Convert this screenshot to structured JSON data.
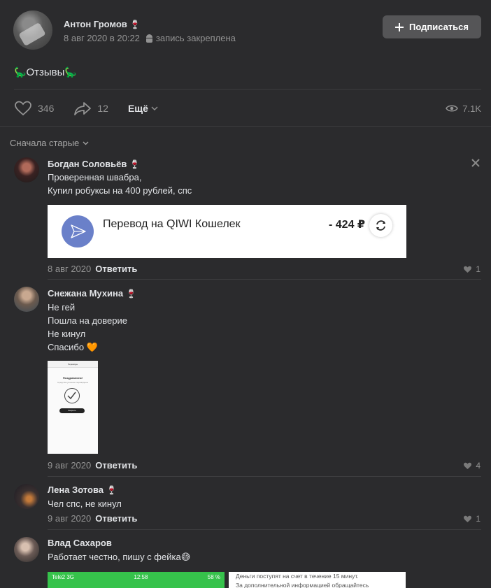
{
  "post": {
    "author": "Антон Громов",
    "wine_emoji": "🍷",
    "date": "8 авг 2020 в 20:22",
    "pinned_label": "запись закреплена",
    "subscribe_label": "Подписаться",
    "text": "Отзывы",
    "dino_emoji": "🦕",
    "likes": "346",
    "shares": "12",
    "more_label": "Ещё",
    "views": "7.1K"
  },
  "comments_sort": {
    "label": "Сначала старые"
  },
  "comments": [
    {
      "name": "Богдан Соловьёв",
      "lines": [
        "Проверенная швабра,",
        "Купил робуксы на 400 рублей, спс"
      ],
      "attachment": {
        "type": "qiwi",
        "title": "Перевод на QIWI Кошелек",
        "amount": "- 424 ₽"
      },
      "date": "8 авг 2020",
      "reply_label": "Ответить",
      "likes": "1"
    },
    {
      "name": "Снежана Мухина",
      "lines": [
        "Не гей",
        "Пошла на доверие",
        "Не кинул",
        "Спасибо 🧡"
      ],
      "attachment": {
        "type": "phone-screenshot",
        "header": "Переводы",
        "title": "Поздравляем!",
        "subtitle": "Средства успешно переведены",
        "button": "Закрыть"
      },
      "date": "9 авг 2020",
      "reply_label": "Ответить",
      "likes": "4"
    },
    {
      "name": "Лена Зотова",
      "lines": [
        "Чел спс, не кинул"
      ],
      "date": "9 авг 2020",
      "reply_label": "Ответить",
      "likes": "1"
    },
    {
      "name": "Влад Сахаров",
      "lines": [
        "Работает честно, пишу с фейка😅"
      ],
      "attachments": {
        "status_left": "Tele2  3G",
        "status_time": "12:58",
        "status_right": "58 %",
        "note_line1": "Деньги поступят на счет в течение 15 минут.",
        "note_line2": "За дополнительной информацией обращайтесь"
      }
    }
  ],
  "colors": {
    "background": "#2b2b2d",
    "button": "#555557",
    "qiwi_logo": "#6a80c9",
    "green_status": "#36c24b"
  }
}
